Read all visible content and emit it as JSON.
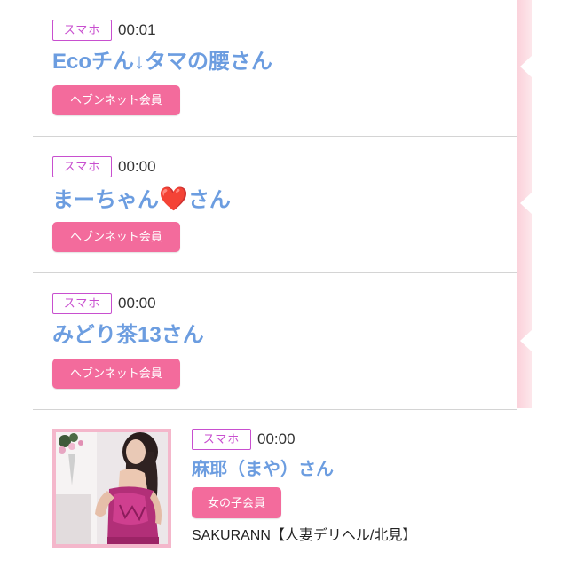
{
  "entries": [
    {
      "device": "スマホ",
      "time": "00:01",
      "name": "Ecoチん↓タマの腰さん",
      "badge": "ヘブンネット会員"
    },
    {
      "device": "スマホ",
      "time": "00:00",
      "name": "まーちゃん❤️さん",
      "badge": "ヘブンネット会員"
    },
    {
      "device": "スマホ",
      "time": "00:00",
      "name": "みどり茶13さん",
      "badge": "ヘブンネット会員"
    },
    {
      "device": "スマホ",
      "time": "00:00",
      "name": "麻耶（まや）さん",
      "badge": "女の子会員",
      "shop": "SAKURANN【人妻デリヘル/北見】"
    }
  ],
  "colors": {
    "device_tag": "#c84fcf",
    "time": "#333333",
    "name": "#6c9de0",
    "heart": "#d42031",
    "badge_bg": "#f36b9c",
    "badge_text": "#ffffff",
    "separator": "#d4d4d4",
    "photo_border": "#f4b7cb",
    "shop_text": "#222222",
    "side_strip": "#fde1e6"
  }
}
